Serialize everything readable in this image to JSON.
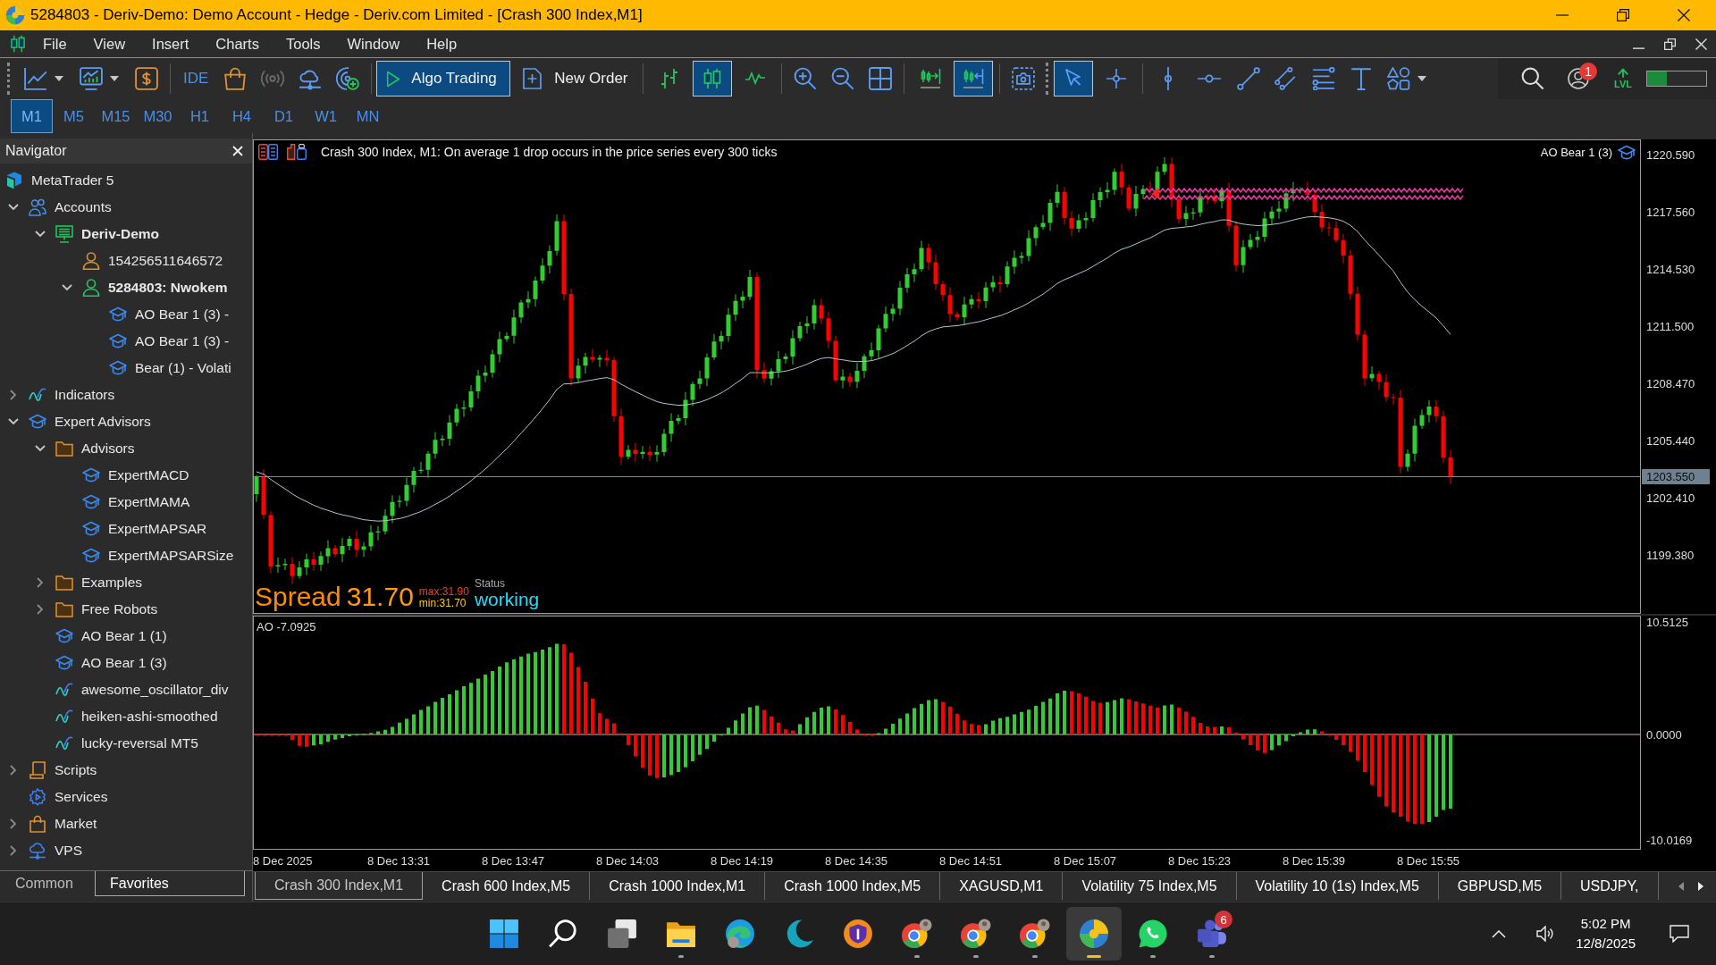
{
  "window": {
    "title": "5284803 - Deriv-Demo: Demo Account - Hedge - Deriv.com Limited - [Crash 300 Index,M1]"
  },
  "menu": [
    "File",
    "View",
    "Insert",
    "Charts",
    "Tools",
    "Window",
    "Help"
  ],
  "toolbar": {
    "ide": "IDE",
    "signals": {
      "disabled": true
    },
    "algo_trading": {
      "label": "Algo Trading",
      "on": true
    },
    "new_order": "New Order",
    "chart_types": [
      {
        "kind": "bars",
        "selected": false
      },
      {
        "kind": "candles",
        "selected": true
      },
      {
        "kind": "line",
        "selected": false
      }
    ],
    "chart_shift": {
      "on": false
    },
    "auto_scroll": {
      "on": true
    },
    "tools": [
      {
        "kind": "cursor",
        "selected": true
      },
      {
        "kind": "crosshair",
        "selected": false
      }
    ],
    "notification_badge": "1",
    "level_label": "LVL",
    "level": 0.33
  },
  "timeframes": [
    {
      "label": "M1",
      "selected": true
    },
    {
      "label": "M5",
      "selected": false
    },
    {
      "label": "M15",
      "selected": false
    },
    {
      "label": "M30",
      "selected": false
    },
    {
      "label": "H1",
      "selected": false
    },
    {
      "label": "H4",
      "selected": false
    },
    {
      "label": "D1",
      "selected": false
    },
    {
      "label": "W1",
      "selected": false
    },
    {
      "label": "MN",
      "selected": false
    }
  ],
  "navigator": {
    "title": "Navigator",
    "tree": [
      {
        "label": "MetaTrader 5",
        "kind": "logo",
        "active": false,
        "children": [
          {
            "label": "Accounts",
            "kind": "accounts",
            "active": false,
            "expanded": true,
            "children": [
              {
                "label": "Deriv-Demo",
                "kind": "server",
                "active": true,
                "expanded": true,
                "children": [
                  {
                    "label": "154256511646572",
                    "kind": "person",
                    "active": false
                  },
                  {
                    "label": "5284803: Nwokem",
                    "kind": "person",
                    "active": true,
                    "expanded": true,
                    "children": [
                      {
                        "label": "AO Bear 1 (3) -",
                        "kind": "expert",
                        "active": false
                      },
                      {
                        "label": "AO Bear 1 (3) -",
                        "kind": "expert",
                        "active": false
                      },
                      {
                        "label": "Bear (1) - Volati",
                        "kind": "expert",
                        "active": false
                      }
                    ]
                  }
                ]
              }
            ]
          },
          {
            "label": "Indicators",
            "kind": "indicator",
            "active": false,
            "expanded": false
          },
          {
            "label": "Expert Advisors",
            "kind": "expert",
            "active": false,
            "expanded": true,
            "children": [
              {
                "label": "Advisors",
                "kind": "folder",
                "active": false,
                "expanded": true,
                "children": [
                  {
                    "label": "ExpertMACD",
                    "kind": "expert",
                    "active": false
                  },
                  {
                    "label": "ExpertMAMA",
                    "kind": "expert",
                    "active": false
                  },
                  {
                    "label": "ExpertMAPSAR",
                    "kind": "expert",
                    "active": false
                  },
                  {
                    "label": "ExpertMAPSARSize",
                    "kind": "expert",
                    "active": false
                  }
                ]
              },
              {
                "label": "Examples",
                "kind": "folder",
                "active": false,
                "expanded": false
              },
              {
                "label": "Free Robots",
                "kind": "folder",
                "active": false,
                "expanded": false
              },
              {
                "label": "AO Bear 1 (1)",
                "kind": "expert",
                "active": false
              },
              {
                "label": "AO Bear 1 (3)",
                "kind": "expert",
                "active": false
              },
              {
                "label": "awesome_oscillator_div",
                "kind": "indicator",
                "active": false
              },
              {
                "label": "heiken-ashi-smoothed",
                "kind": "indicator",
                "active": false
              },
              {
                "label": "lucky-reversal MT5",
                "kind": "indicator",
                "active": false
              }
            ]
          },
          {
            "label": "Scripts",
            "kind": "script",
            "active": false,
            "expanded": false
          },
          {
            "label": "Services",
            "kind": "services",
            "active": false
          },
          {
            "label": "Market",
            "kind": "market",
            "active": false,
            "expanded": false
          },
          {
            "label": "VPS",
            "kind": "vps",
            "active": false,
            "expanded": false
          }
        ]
      }
    ],
    "tabs": [
      {
        "label": "Common",
        "selected": false
      },
      {
        "label": "Favorites",
        "selected": true
      }
    ]
  },
  "chart": {
    "info": "Crash 300 Index, M1: On average 1 drop occurs in the price series every 300 ticks",
    "expert": "AO Bear 1 (3)",
    "price_labels": [
      "1220.590",
      "1217.560",
      "1214.530",
      "1211.500",
      "1208.470",
      "1205.440",
      "1202.410",
      "1199.380"
    ],
    "current_price": "1203.550",
    "spread": {
      "label": "Spread",
      "value": "31.70",
      "max": "max:31.90",
      "min": "min:31.70",
      "status_label": "Status",
      "status": "working"
    },
    "oscillator": {
      "label": "AO -7.0925",
      "scale": [
        "10.5125",
        "0.0000",
        "-10.0169"
      ]
    },
    "time_labels": [
      "8 Dec 2025",
      "8 Dec 13:31",
      "8 Dec 13:47",
      "8 Dec 14:03",
      "8 Dec 14:19",
      "8 Dec 14:35",
      "8 Dec 14:51",
      "8 Dec 15:07",
      "8 Dec 15:23",
      "8 Dec 15:39",
      "8 Dec 15:55"
    ]
  },
  "chart_tabs": [
    {
      "label": "Crash 300 Index,M1",
      "selected": true
    },
    {
      "label": "Crash 600 Index,M5",
      "selected": false
    },
    {
      "label": "Crash 1000 Index,M1",
      "selected": false
    },
    {
      "label": "Crash 1000 Index,M5",
      "selected": false
    },
    {
      "label": "XAGUSD,M1",
      "selected": false
    },
    {
      "label": "Volatility 75 Index,M5",
      "selected": false
    },
    {
      "label": "Volatility 10 (1s) Index,M5",
      "selected": false
    },
    {
      "label": "GBPUSD,M5",
      "selected": false
    },
    {
      "label": "USDJPY,",
      "selected": false
    }
  ],
  "taskbar": {
    "apps": [
      {
        "kind": "start",
        "running": false,
        "selected": false
      },
      {
        "kind": "search",
        "running": false,
        "selected": false
      },
      {
        "kind": "task-view",
        "running": false,
        "selected": false
      },
      {
        "kind": "explorer",
        "running": true,
        "selected": false
      },
      {
        "kind": "edge",
        "running": false,
        "selected": false
      },
      {
        "kind": "crescent",
        "running": false,
        "selected": false
      },
      {
        "kind": "shield",
        "running": false,
        "selected": false
      },
      {
        "kind": "chrome",
        "running": true,
        "selected": false
      },
      {
        "kind": "chrome",
        "running": true,
        "selected": false
      },
      {
        "kind": "chrome",
        "running": true,
        "selected": false
      },
      {
        "kind": "metatrader",
        "running": true,
        "selected": true
      },
      {
        "kind": "whatsapp",
        "running": true,
        "selected": false
      },
      {
        "kind": "teams",
        "running": true,
        "selected": false,
        "badge": "6"
      }
    ],
    "time": "5:02 PM",
    "date": "12/8/2025"
  }
}
